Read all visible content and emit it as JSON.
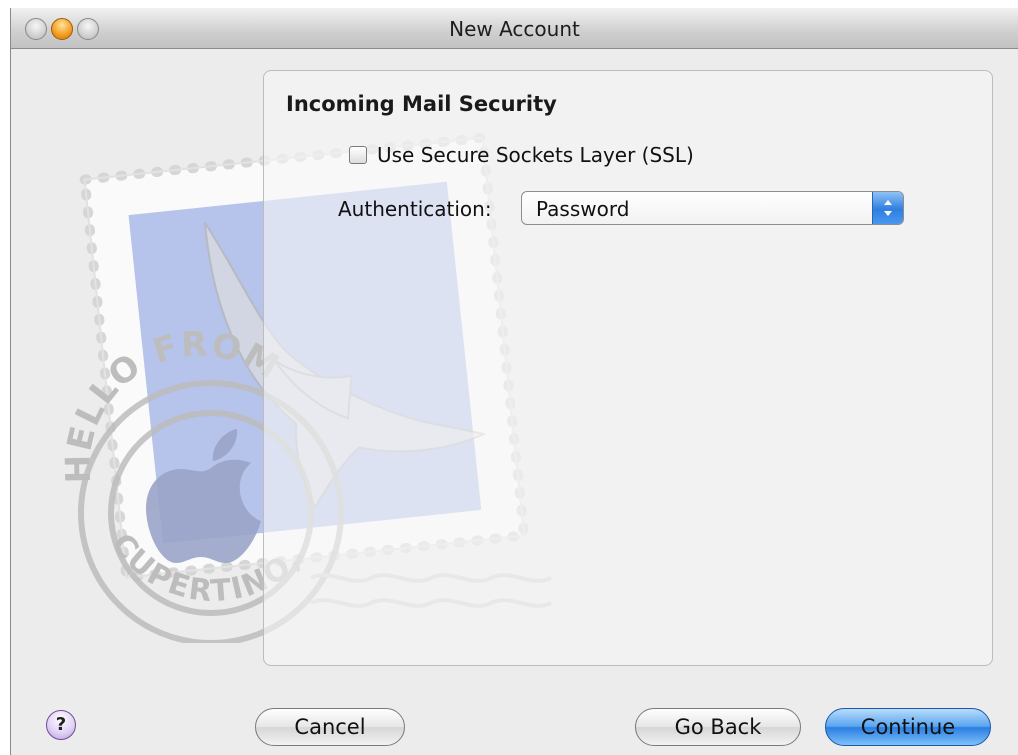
{
  "window": {
    "title": "New Account"
  },
  "stamp": {
    "text_top": "HELLO FROM",
    "text_bottom": "CUPERTINO, CA"
  },
  "incoming_security": {
    "heading": "Incoming Mail Security",
    "ssl_label": "Use Secure Sockets Layer (SSL)",
    "ssl_checked": false,
    "authentication_label": "Authentication:",
    "authentication_value": "Password"
  },
  "footer": {
    "help_label": "?",
    "cancel_label": "Cancel",
    "go_back_label": "Go Back",
    "continue_label": "Continue"
  },
  "colors": {
    "accent_blue": "#2b7fe2",
    "window_bg": "#ececec"
  }
}
